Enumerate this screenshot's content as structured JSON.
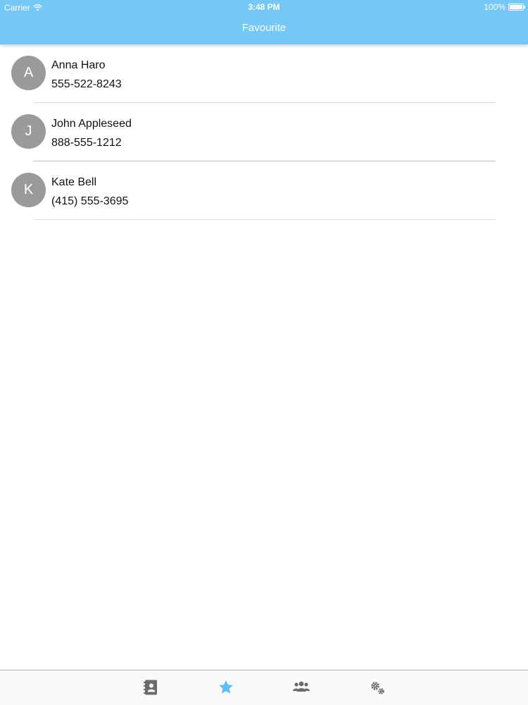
{
  "status_bar": {
    "carrier": "Carrier",
    "time": "3:48 PM",
    "battery_text": "100%",
    "battery_level": 1.0
  },
  "nav": {
    "title": "Favourite"
  },
  "contacts": [
    {
      "initial": "A",
      "name": "Anna Haro",
      "phone": "555-522-8243"
    },
    {
      "initial": "J",
      "name": "John Appleseed",
      "phone": "888-555-1212"
    },
    {
      "initial": "K",
      "name": "Kate Bell",
      "phone": "(415) 555-3695"
    }
  ],
  "tabbar": {
    "tabs": [
      {
        "icon": "contacts-book-icon",
        "selected": false
      },
      {
        "icon": "star-icon",
        "selected": true
      },
      {
        "icon": "group-icon",
        "selected": false
      },
      {
        "icon": "settings-gears-icon",
        "selected": false
      }
    ]
  },
  "colors": {
    "accent": "#74c7f6",
    "avatar": "#9a9a9c",
    "tab_inactive": "#6b6b6b",
    "tab_active": "#5bbdf5"
  }
}
